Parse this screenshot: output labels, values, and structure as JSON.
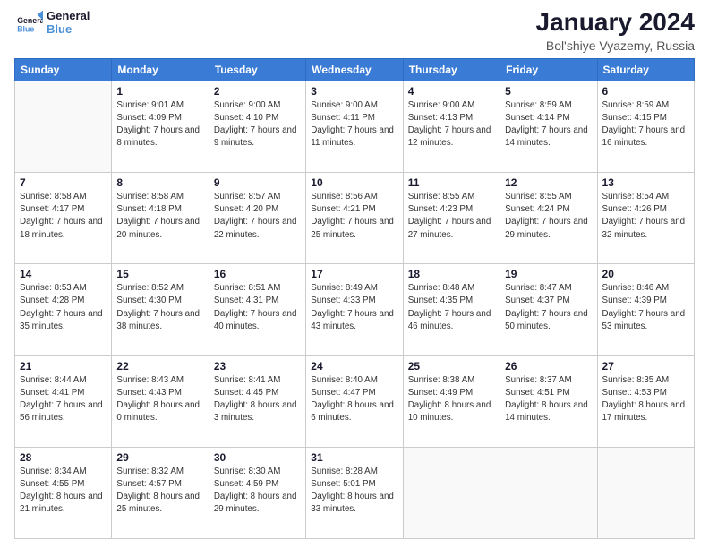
{
  "logo": {
    "line1": "General",
    "line2": "Blue"
  },
  "title": "January 2024",
  "subtitle": "Bol'shiye Vyazemy, Russia",
  "weekdays": [
    "Sunday",
    "Monday",
    "Tuesday",
    "Wednesday",
    "Thursday",
    "Friday",
    "Saturday"
  ],
  "weeks": [
    [
      {
        "day": "",
        "info": ""
      },
      {
        "day": "1",
        "sunrise": "9:01 AM",
        "sunset": "4:09 PM",
        "daylight": "7 hours and 8 minutes."
      },
      {
        "day": "2",
        "sunrise": "9:00 AM",
        "sunset": "4:10 PM",
        "daylight": "7 hours and 9 minutes."
      },
      {
        "day": "3",
        "sunrise": "9:00 AM",
        "sunset": "4:11 PM",
        "daylight": "7 hours and 11 minutes."
      },
      {
        "day": "4",
        "sunrise": "9:00 AM",
        "sunset": "4:13 PM",
        "daylight": "7 hours and 12 minutes."
      },
      {
        "day": "5",
        "sunrise": "8:59 AM",
        "sunset": "4:14 PM",
        "daylight": "7 hours and 14 minutes."
      },
      {
        "day": "6",
        "sunrise": "8:59 AM",
        "sunset": "4:15 PM",
        "daylight": "7 hours and 16 minutes."
      }
    ],
    [
      {
        "day": "7",
        "sunrise": "8:58 AM",
        "sunset": "4:17 PM",
        "daylight": "7 hours and 18 minutes."
      },
      {
        "day": "8",
        "sunrise": "8:58 AM",
        "sunset": "4:18 PM",
        "daylight": "7 hours and 20 minutes."
      },
      {
        "day": "9",
        "sunrise": "8:57 AM",
        "sunset": "4:20 PM",
        "daylight": "7 hours and 22 minutes."
      },
      {
        "day": "10",
        "sunrise": "8:56 AM",
        "sunset": "4:21 PM",
        "daylight": "7 hours and 25 minutes."
      },
      {
        "day": "11",
        "sunrise": "8:55 AM",
        "sunset": "4:23 PM",
        "daylight": "7 hours and 27 minutes."
      },
      {
        "day": "12",
        "sunrise": "8:55 AM",
        "sunset": "4:24 PM",
        "daylight": "7 hours and 29 minutes."
      },
      {
        "day": "13",
        "sunrise": "8:54 AM",
        "sunset": "4:26 PM",
        "daylight": "7 hours and 32 minutes."
      }
    ],
    [
      {
        "day": "14",
        "sunrise": "8:53 AM",
        "sunset": "4:28 PM",
        "daylight": "7 hours and 35 minutes."
      },
      {
        "day": "15",
        "sunrise": "8:52 AM",
        "sunset": "4:30 PM",
        "daylight": "7 hours and 38 minutes."
      },
      {
        "day": "16",
        "sunrise": "8:51 AM",
        "sunset": "4:31 PM",
        "daylight": "7 hours and 40 minutes."
      },
      {
        "day": "17",
        "sunrise": "8:49 AM",
        "sunset": "4:33 PM",
        "daylight": "7 hours and 43 minutes."
      },
      {
        "day": "18",
        "sunrise": "8:48 AM",
        "sunset": "4:35 PM",
        "daylight": "7 hours and 46 minutes."
      },
      {
        "day": "19",
        "sunrise": "8:47 AM",
        "sunset": "4:37 PM",
        "daylight": "7 hours and 50 minutes."
      },
      {
        "day": "20",
        "sunrise": "8:46 AM",
        "sunset": "4:39 PM",
        "daylight": "7 hours and 53 minutes."
      }
    ],
    [
      {
        "day": "21",
        "sunrise": "8:44 AM",
        "sunset": "4:41 PM",
        "daylight": "7 hours and 56 minutes."
      },
      {
        "day": "22",
        "sunrise": "8:43 AM",
        "sunset": "4:43 PM",
        "daylight": "8 hours and 0 minutes."
      },
      {
        "day": "23",
        "sunrise": "8:41 AM",
        "sunset": "4:45 PM",
        "daylight": "8 hours and 3 minutes."
      },
      {
        "day": "24",
        "sunrise": "8:40 AM",
        "sunset": "4:47 PM",
        "daylight": "8 hours and 6 minutes."
      },
      {
        "day": "25",
        "sunrise": "8:38 AM",
        "sunset": "4:49 PM",
        "daylight": "8 hours and 10 minutes."
      },
      {
        "day": "26",
        "sunrise": "8:37 AM",
        "sunset": "4:51 PM",
        "daylight": "8 hours and 14 minutes."
      },
      {
        "day": "27",
        "sunrise": "8:35 AM",
        "sunset": "4:53 PM",
        "daylight": "8 hours and 17 minutes."
      }
    ],
    [
      {
        "day": "28",
        "sunrise": "8:34 AM",
        "sunset": "4:55 PM",
        "daylight": "8 hours and 21 minutes."
      },
      {
        "day": "29",
        "sunrise": "8:32 AM",
        "sunset": "4:57 PM",
        "daylight": "8 hours and 25 minutes."
      },
      {
        "day": "30",
        "sunrise": "8:30 AM",
        "sunset": "4:59 PM",
        "daylight": "8 hours and 29 minutes."
      },
      {
        "day": "31",
        "sunrise": "8:28 AM",
        "sunset": "5:01 PM",
        "daylight": "8 hours and 33 minutes."
      },
      {
        "day": "",
        "info": ""
      },
      {
        "day": "",
        "info": ""
      },
      {
        "day": "",
        "info": ""
      }
    ]
  ]
}
